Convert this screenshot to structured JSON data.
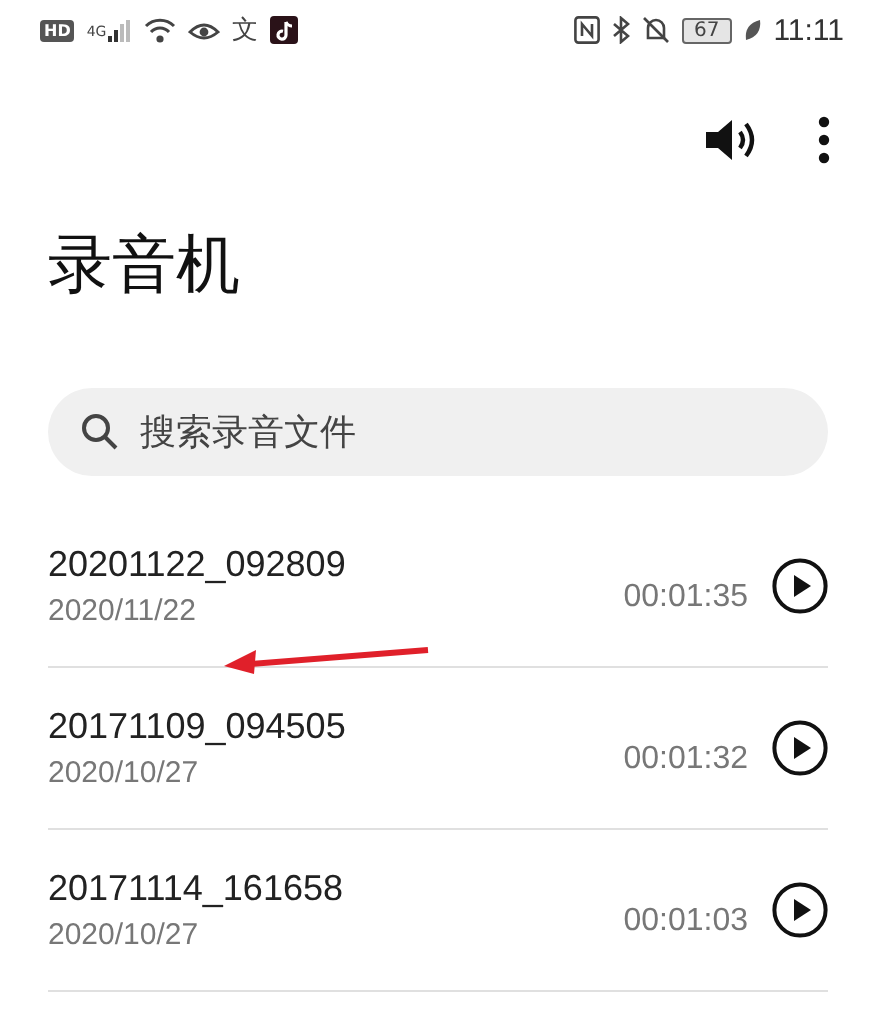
{
  "status_bar": {
    "hd": "HD",
    "network": "4G",
    "text_icon": "文",
    "battery": "67",
    "time": "11:11"
  },
  "app_title": "录音机",
  "search": {
    "placeholder": "搜索录音文件"
  },
  "recordings": [
    {
      "name": "20201122_092809",
      "date": "2020/11/22",
      "duration": "00:01:35"
    },
    {
      "name": "20171109_094505",
      "date": "2020/10/27",
      "duration": "00:01:32"
    },
    {
      "name": "20171114_161658",
      "date": "2020/10/27",
      "duration": "00:01:03"
    }
  ]
}
